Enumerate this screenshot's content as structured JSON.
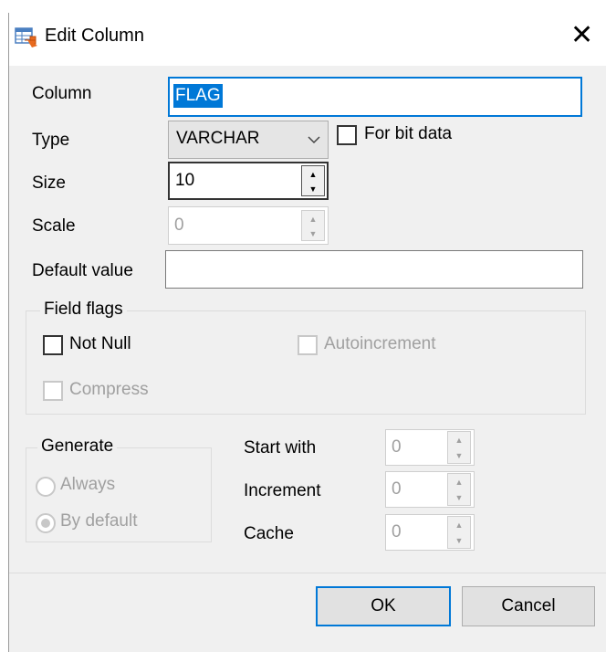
{
  "window": {
    "title": "Edit Column",
    "close_glyph": "✕",
    "icon": "table-edit-icon"
  },
  "fields": {
    "column_label": "Column",
    "column_value": "FLAG",
    "type_label": "Type",
    "type_value": "VARCHAR",
    "for_bit_data_label": "For bit data",
    "size_label": "Size",
    "size_value": "10",
    "scale_label": "Scale",
    "scale_value": "0",
    "default_label": "Default value",
    "default_value": ""
  },
  "field_flags": {
    "title": "Field flags",
    "not_null": "Not Null",
    "autoincrement": "Autoincrement",
    "compress": "Compress"
  },
  "generate": {
    "title": "Generate",
    "always": "Always",
    "by_default": "By default",
    "selected": "By default"
  },
  "identity": {
    "start_with_label": "Start with",
    "start_with_value": "0",
    "increment_label": "Increment",
    "increment_value": "0",
    "cache_label": "Cache",
    "cache_value": "0"
  },
  "buttons": {
    "ok": "OK",
    "cancel": "Cancel"
  },
  "colors": {
    "accent": "#0078d7",
    "dialog_bg": "#f0f0f0",
    "disabled_text": "#a0a0a0"
  }
}
